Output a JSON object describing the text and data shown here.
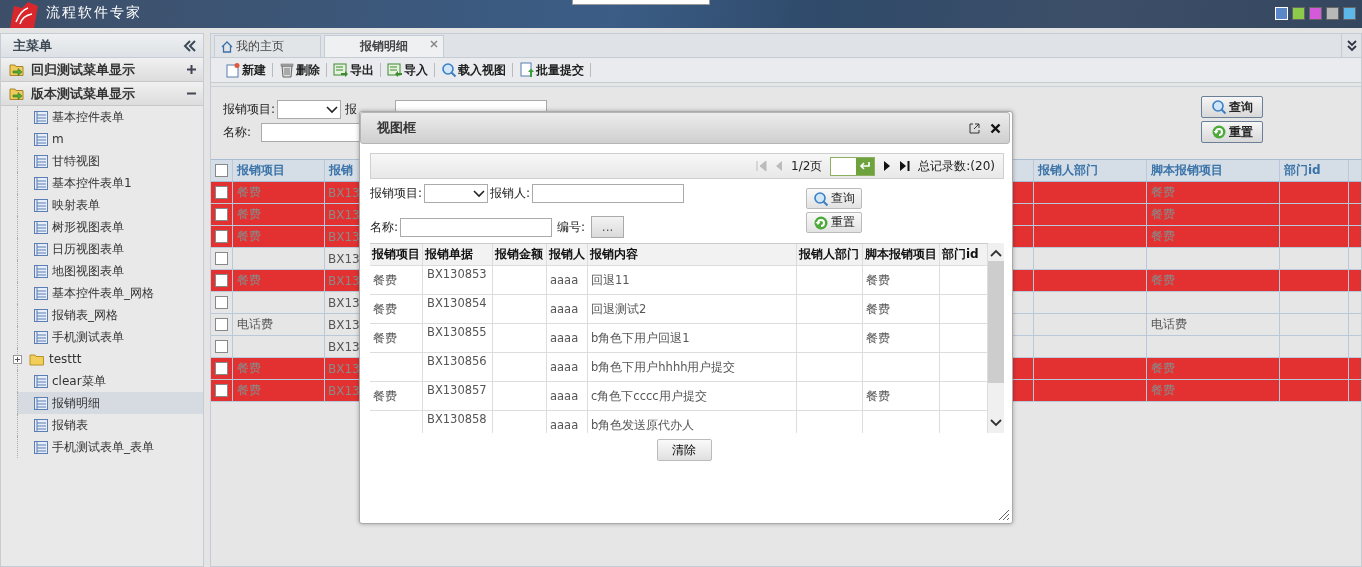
{
  "header": {
    "brand": "流程软件专家",
    "theme_swatches": [
      {
        "color": "#5b86c8",
        "selected": true
      },
      {
        "color": "#8ccc4a",
        "selected": false
      },
      {
        "color": "#d35ad8",
        "selected": false
      },
      {
        "color": "#b8b8b8",
        "selected": false
      },
      {
        "color": "#5cb8e8",
        "selected": false
      }
    ]
  },
  "sidebar": {
    "title": "主菜单",
    "groups": [
      {
        "label": "回归测试菜单显示",
        "expanded": false
      },
      {
        "label": "版本测试菜单显示",
        "expanded": true,
        "items": [
          {
            "label": "基本控件表单",
            "kind": "form",
            "selected": false
          },
          {
            "label": "m",
            "kind": "form",
            "selected": false
          },
          {
            "label": "甘特视图",
            "kind": "form",
            "selected": false
          },
          {
            "label": "基本控件表单1",
            "kind": "form",
            "selected": false
          },
          {
            "label": "映射表单",
            "kind": "form",
            "selected": false
          },
          {
            "label": "树形视图表单",
            "kind": "form",
            "selected": false
          },
          {
            "label": "日历视图表单",
            "kind": "form",
            "selected": false
          },
          {
            "label": "地图视图表单",
            "kind": "form",
            "selected": false
          },
          {
            "label": "基本控件表单_网格",
            "kind": "form",
            "selected": false
          },
          {
            "label": "报销表_网格",
            "kind": "form",
            "selected": false
          },
          {
            "label": "手机测试表单",
            "kind": "form",
            "selected": false
          },
          {
            "label": "testtt",
            "kind": "folder",
            "expanded": false,
            "selected": false
          },
          {
            "label": "clear菜单",
            "kind": "form",
            "selected": false
          },
          {
            "label": "报销明细",
            "kind": "form",
            "selected": true
          },
          {
            "label": "报销表",
            "kind": "form",
            "selected": false
          },
          {
            "label": "手机测试表单_表单",
            "kind": "form",
            "selected": false
          }
        ]
      }
    ]
  },
  "tabs": [
    {
      "label": "我的主页",
      "kind": "home",
      "selected": false,
      "closable": false
    },
    {
      "label": "报销明细",
      "kind": "plain",
      "selected": true,
      "closable": true
    }
  ],
  "toolbar": [
    {
      "label": "新建",
      "kind": "new"
    },
    {
      "label": "删除",
      "kind": "delete"
    },
    {
      "label": "导出",
      "kind": "export"
    },
    {
      "label": "导入",
      "kind": "import"
    },
    {
      "label": "载入视图",
      "kind": "search"
    },
    {
      "label": "批量提交",
      "kind": "submit"
    }
  ],
  "search": {
    "fields": [
      {
        "label": "报销项目:",
        "kind": "select"
      },
      {
        "label": "报",
        "kind": "text"
      },
      {
        "label": "名称:",
        "kind": "text"
      }
    ],
    "buttons": [
      {
        "label": "查询",
        "kind": "search"
      },
      {
        "label": "重置",
        "kind": "reset"
      }
    ]
  },
  "grid": {
    "header_checked": false,
    "columns": [
      "报销项目",
      "报销",
      "报销人部门",
      "脚本报销项目",
      "部门id"
    ],
    "rows": [
      {
        "checked": false,
        "highlighted": true,
        "item": "餐费",
        "doc": "BX13",
        "script_item": "餐费"
      },
      {
        "checked": false,
        "highlighted": true,
        "item": "餐费",
        "doc": "BX13",
        "script_item": "餐费"
      },
      {
        "checked": false,
        "highlighted": true,
        "item": "餐费",
        "doc": "BX13",
        "script_item": "餐费"
      },
      {
        "checked": false,
        "highlighted": false,
        "item": "",
        "doc": "BX13",
        "script_item": ""
      },
      {
        "checked": false,
        "highlighted": true,
        "item": "餐费",
        "doc": "BX13",
        "script_item": "餐费"
      },
      {
        "checked": false,
        "highlighted": false,
        "item": "",
        "doc": "BX13",
        "script_item": ""
      },
      {
        "checked": false,
        "highlighted": false,
        "item": "电话费",
        "doc": "BX13",
        "script_item": "电话费"
      },
      {
        "checked": false,
        "highlighted": false,
        "item": "",
        "doc": "BX13",
        "script_item": ""
      },
      {
        "checked": false,
        "highlighted": true,
        "item": "餐费",
        "doc": "BX13",
        "script_item": "餐费"
      },
      {
        "checked": false,
        "highlighted": true,
        "item": "餐费",
        "doc": "BX13",
        "script_item": "餐费"
      }
    ]
  },
  "dialog": {
    "title": "视图框",
    "pager": {
      "page": "1/2页",
      "total": "总记录数:(20)"
    },
    "fields": [
      {
        "label": "报销项目:",
        "kind": "select"
      },
      {
        "label": "报销人:",
        "kind": "text"
      },
      {
        "label": "名称:",
        "kind": "text"
      },
      {
        "label": "编号:",
        "kind": "lookup",
        "button": "..."
      }
    ],
    "buttons": [
      {
        "label": "查询",
        "kind": "search"
      },
      {
        "label": "重置",
        "kind": "reset"
      }
    ],
    "columns": [
      "报销项目",
      "报销单据",
      "报销金额",
      "报销人",
      "报销内容",
      "报销人部门",
      "脚本报销项目",
      "部门id"
    ],
    "rows": [
      [
        "餐费",
        "BX130853",
        "",
        "aaaa",
        "回退11",
        "",
        "餐费",
        ""
      ],
      [
        "餐费",
        "BX130854",
        "",
        "aaaa",
        "回退测试2",
        "",
        "餐费",
        ""
      ],
      [
        "餐费",
        "BX130855",
        "",
        "aaaa",
        "b角色下用户回退1",
        "",
        "餐费",
        ""
      ],
      [
        "",
        "BX130856",
        "",
        "aaaa",
        "b角色下用户hhhh用户提交",
        "",
        "",
        ""
      ],
      [
        "餐费",
        "BX130857",
        "",
        "aaaa",
        "c角色下cccc用户提交",
        "",
        "餐费",
        ""
      ],
      [
        "",
        "BX130858",
        "",
        "aaaa",
        "b角色发送原代办人",
        "",
        "",
        ""
      ]
    ],
    "clear_button": "清除"
  }
}
